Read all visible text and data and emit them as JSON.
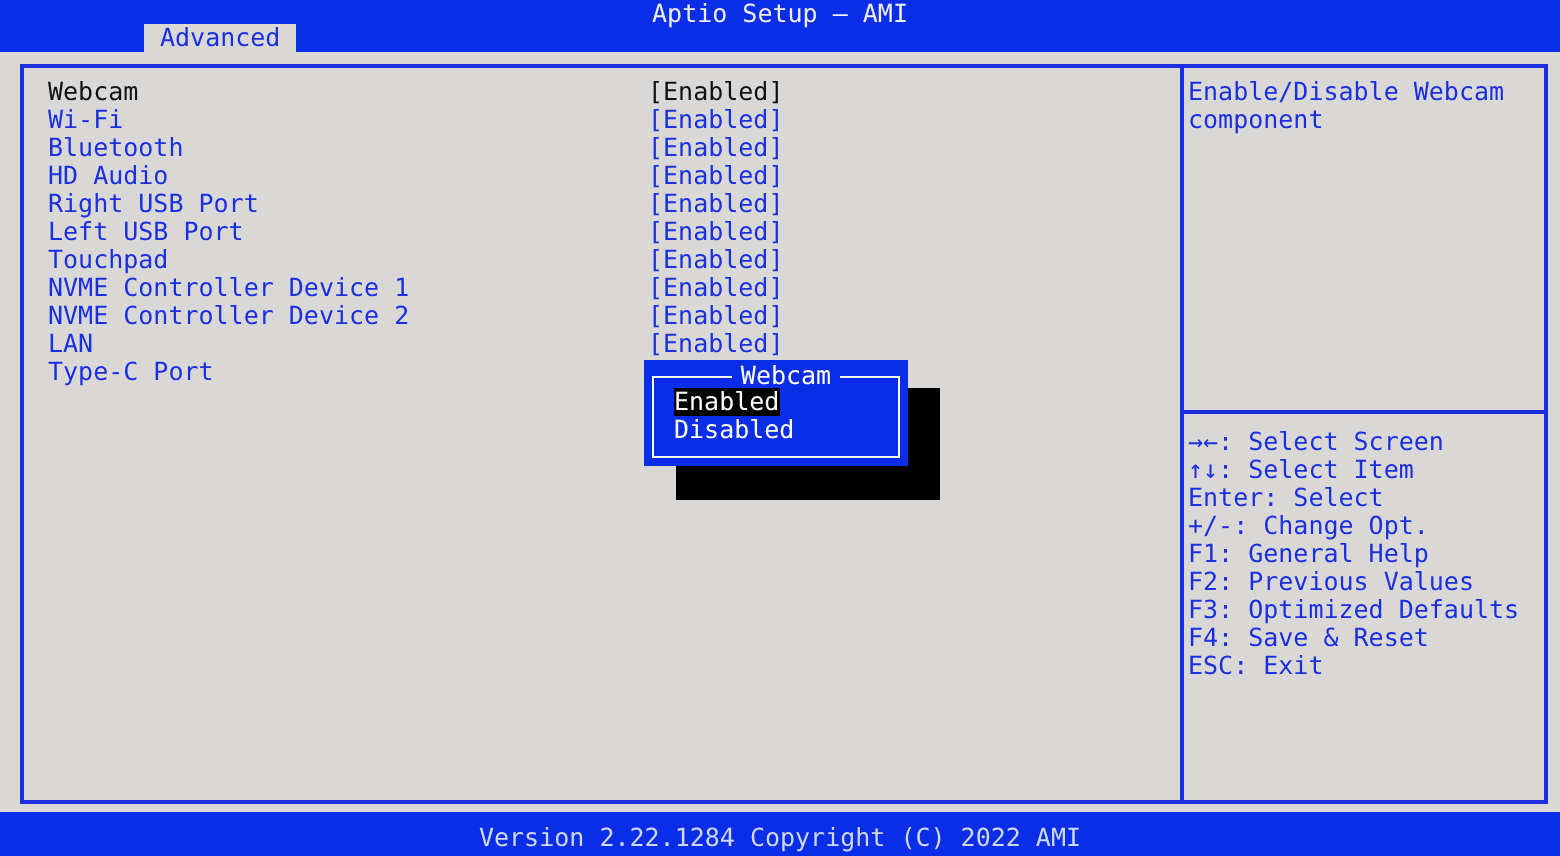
{
  "window": {
    "title": "Aptio Setup – AMI"
  },
  "tabs": [
    {
      "label": "Advanced",
      "selected": true
    }
  ],
  "settings": [
    {
      "label": "Webcam",
      "value": "[Enabled]",
      "selected": true
    },
    {
      "label": "Wi-Fi",
      "value": "[Enabled]",
      "selected": false
    },
    {
      "label": "Bluetooth",
      "value": "[Enabled]",
      "selected": false
    },
    {
      "label": "HD Audio",
      "value": "[Enabled]",
      "selected": false
    },
    {
      "label": "Right USB Port",
      "value": "[Enabled]",
      "selected": false
    },
    {
      "label": "Left USB Port",
      "value": "[Enabled]",
      "selected": false
    },
    {
      "label": "Touchpad",
      "value": "[Enabled]",
      "selected": false
    },
    {
      "label": "NVME Controller Device 1",
      "value": "[Enabled]",
      "selected": false
    },
    {
      "label": "NVME Controller Device 2",
      "value": "[Enabled]",
      "selected": false
    },
    {
      "label": "LAN",
      "value": "[Enabled]",
      "selected": false
    },
    {
      "label": "Type-C Port",
      "selected": false
    }
  ],
  "popup": {
    "title": "Webcam",
    "options": [
      {
        "label": "Enabled",
        "selected": true
      },
      {
        "label": "Disabled",
        "selected": false
      }
    ]
  },
  "help_text": "Enable/Disable Webcam component",
  "key_help": [
    "→←: Select Screen",
    "↑↓: Select Item",
    "Enter: Select",
    "+/-: Change Opt.",
    "F1: General Help",
    "F2: Previous Values",
    "F3: Optimized Defaults",
    "F4: Save & Reset",
    "ESC: Exit"
  ],
  "status_bar": "Version 2.22.1284 Copyright (C) 2022 AMI"
}
